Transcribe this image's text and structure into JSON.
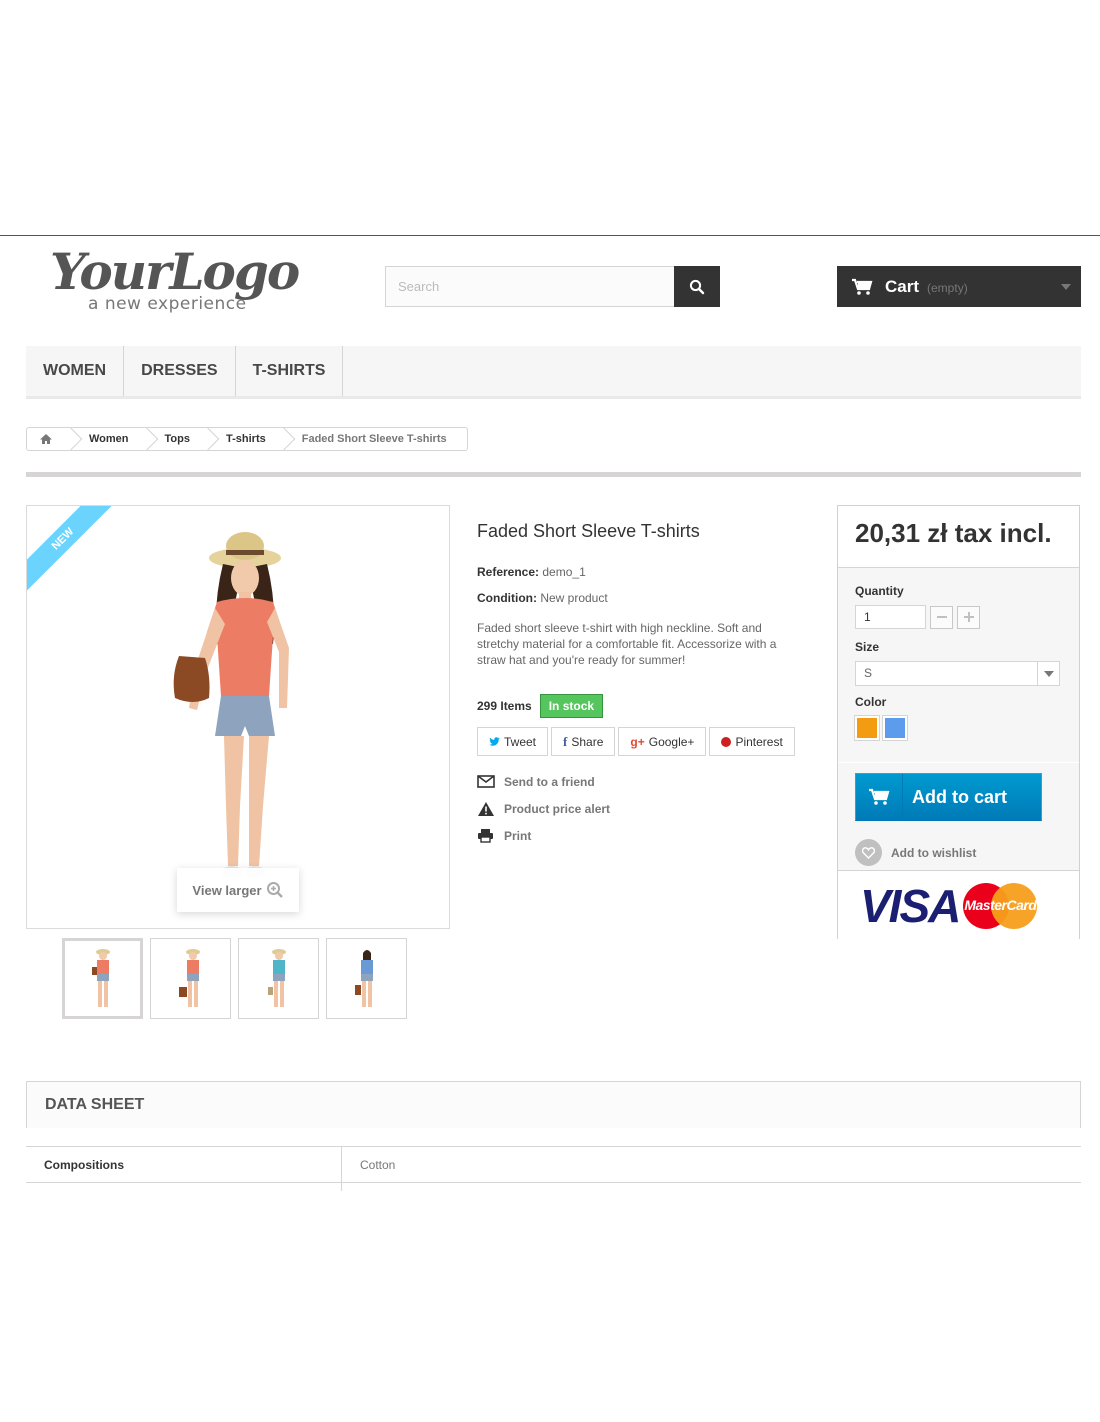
{
  "header": {
    "logo_script": "YourLogo",
    "logo_tagline": "a new experience",
    "search_placeholder": "Search",
    "cart_label": "Cart",
    "cart_status": "(empty)"
  },
  "menu": {
    "items": [
      {
        "label": "WOMEN"
      },
      {
        "label": "DRESSES"
      },
      {
        "label": "T-SHIRTS"
      }
    ]
  },
  "breadcrumb": {
    "items": [
      "Women",
      "Tops",
      "T-shirts"
    ],
    "current": "Faded Short Sleeve T-shirts"
  },
  "product": {
    "badge": "NEW",
    "view_larger": "View larger",
    "name": "Faded Short Sleeve T-shirts",
    "reference_label": "Reference:",
    "reference_value": "demo_1",
    "condition_label": "Condition:",
    "condition_value": "New product",
    "description": "Faded short sleeve t-shirt with high neckline. Soft and stretchy material for a comfortable fit. Accessorize with a straw hat and you're ready for summer!",
    "quantity_available": "299 Items",
    "stock_status": "In stock",
    "social": {
      "tweet": "Tweet",
      "share": "Share",
      "google": "Google+",
      "pinterest": "Pinterest"
    },
    "links": {
      "send": "Send to a friend",
      "alert": "Product price alert",
      "print": "Print"
    }
  },
  "buy": {
    "price": "20,31 zł tax incl.",
    "quantity_label": "Quantity",
    "quantity_value": "1",
    "size_label": "Size",
    "size_value": "S",
    "color_label": "Color",
    "colors": [
      "#f39c11",
      "#5d9cec"
    ],
    "add_to_cart": "Add to cart",
    "wishlist": "Add to wishlist",
    "card_visa": "VISA",
    "card_mc": "MasterCard"
  },
  "datasheet": {
    "title": "DATA SHEET",
    "rows": [
      {
        "key": "Compositions",
        "value": "Cotton"
      }
    ]
  }
}
